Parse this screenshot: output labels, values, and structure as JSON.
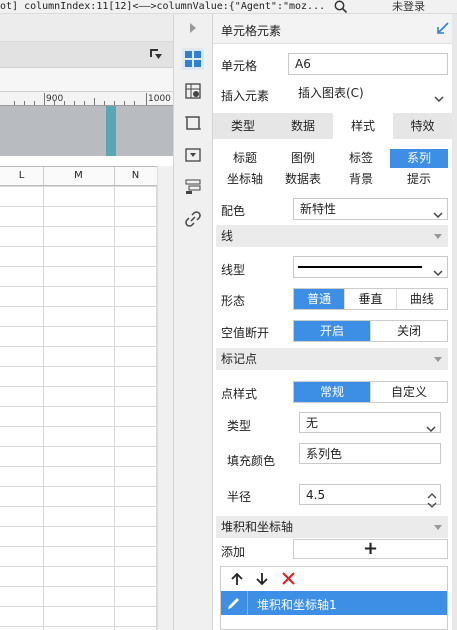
{
  "topbar": {
    "code_text": "ot] columnIndex:11[12]<——>columnValue:{\"Agent\":\"moz...",
    "login_label": "未登录"
  },
  "sheet": {
    "ruler_labels": [
      "900",
      "1000"
    ],
    "columns": [
      "L",
      "M",
      "N"
    ]
  },
  "panel": {
    "title": "单元格元素",
    "cell_label": "单元格",
    "cell_value": "A6",
    "insert_label": "插入元素",
    "insert_value": "插入图表(C)",
    "main_tabs": [
      "类型",
      "数据",
      "样式",
      "特效"
    ],
    "active_main_tab": "样式",
    "sub_tabs_row1": [
      "标题",
      "图例",
      "标签",
      "系列"
    ],
    "sub_tabs_row2": [
      "坐标轴",
      "数据表",
      "背景",
      "提示"
    ],
    "active_sub_tab": "系列",
    "color_label": "配色",
    "color_value": "新特性",
    "line_section": "线",
    "line_type_label": "线型",
    "shape_label": "形态",
    "shape_options": [
      "普通",
      "垂直",
      "曲线"
    ],
    "shape_selected": "普通",
    "null_break_label": "空值断开",
    "null_break_options": [
      "开启",
      "关闭"
    ],
    "null_break_selected": "开启",
    "marker_section": "标记点",
    "marker_style_label": "点样式",
    "marker_style_options": [
      "常规",
      "自定义"
    ],
    "marker_style_selected": "常规",
    "type_label": "类型",
    "type_value": "无",
    "fill_label": "填充颜色",
    "fill_value": "系列色",
    "radius_label": "半径",
    "radius_value": "4.5",
    "stack_section": "堆积和坐标轴",
    "add_label": "添加",
    "add_button": "+",
    "list_items": [
      "堆积和坐标轴1"
    ]
  },
  "colors": {
    "accent": "#3d8fe6",
    "delete": "#e02020",
    "ruler_marker": "#5aa6b4"
  }
}
